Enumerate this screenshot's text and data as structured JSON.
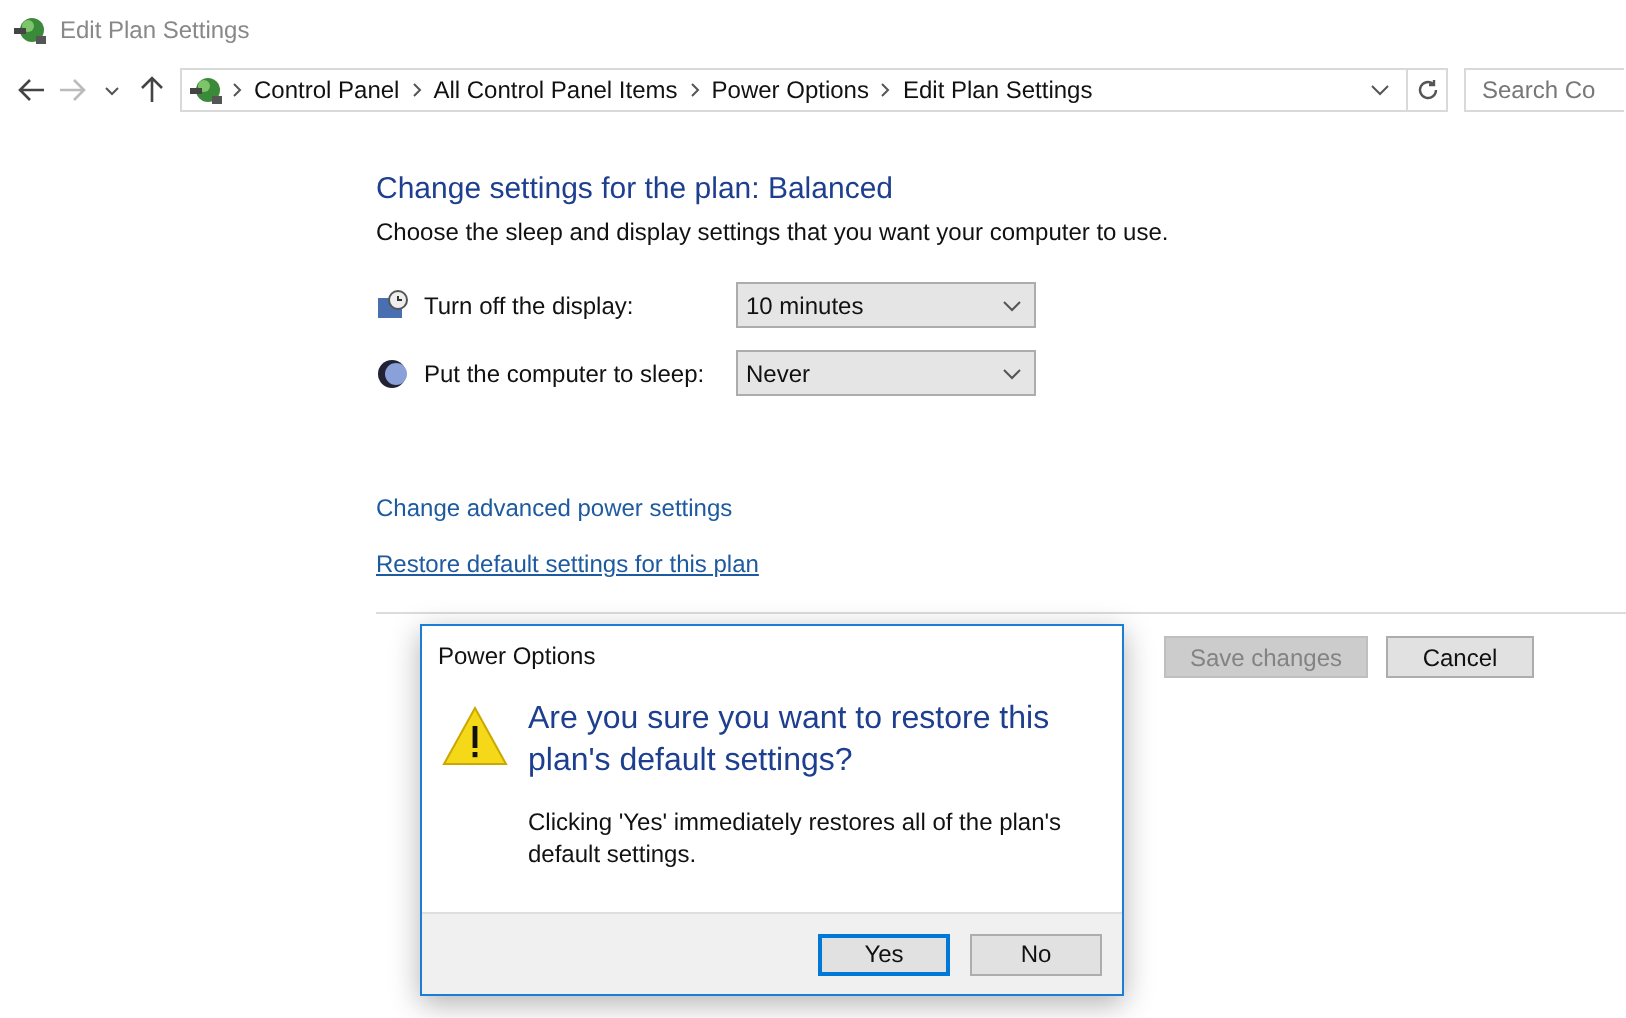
{
  "window": {
    "title": "Edit Plan Settings"
  },
  "address_bar": {
    "breadcrumbs": [
      "Control Panel",
      "All Control Panel Items",
      "Power Options",
      "Edit Plan Settings"
    ],
    "search_placeholder": "Search Co"
  },
  "heading": "Change settings for the plan: Balanced",
  "description": "Choose the sleep and display settings that you want your computer to use.",
  "settings": [
    {
      "kind": "display",
      "label": "Turn off the display:",
      "value": "10 minutes"
    },
    {
      "kind": "sleep",
      "label": "Put the computer to sleep:",
      "value": "Never"
    }
  ],
  "links": [
    {
      "label": "Change advanced power settings",
      "underlined": false
    },
    {
      "label": "Restore default settings for this plan",
      "underlined": true
    }
  ],
  "buttons": [
    {
      "label": "Save changes",
      "disabled": true
    },
    {
      "label": "Cancel",
      "disabled": false
    }
  ],
  "dialog": {
    "title": "Power Options",
    "question": "Are you sure you want to restore this plan's default settings?",
    "message": "Clicking 'Yes' immediately restores all of the plan's default settings.",
    "buttons": [
      {
        "label": "Yes",
        "focused": true
      },
      {
        "label": "No",
        "focused": false
      }
    ]
  }
}
